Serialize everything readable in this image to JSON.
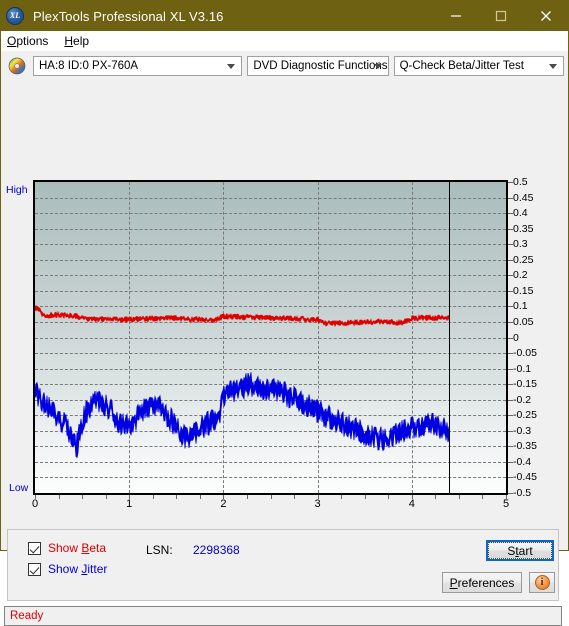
{
  "window": {
    "title": "PlexTools Professional XL V3.16",
    "icon": "app-xl-icon",
    "icon_text": "XL",
    "titlebar_color": "#6e6111",
    "minimize_label": "Minimize",
    "maximize_label": "Maximize",
    "close_label": "Close"
  },
  "menubar": {
    "items": [
      {
        "label": "Options",
        "accel": "O"
      },
      {
        "label": "Help",
        "accel": "H"
      }
    ]
  },
  "toolbar": {
    "drive_icon": "optical-disc-icon",
    "drive_select": {
      "value": "HA:8 ID:0  PX-760A",
      "options": [
        "HA:8 ID:0  PX-760A"
      ]
    },
    "function_select": {
      "value": "DVD Diagnostic Functions",
      "options": [
        "DVD Diagnostic Functions"
      ]
    },
    "test_select": {
      "value": "Q-Check Beta/Jitter Test",
      "options": [
        "Q-Check Beta/Jitter Test"
      ]
    }
  },
  "controls": {
    "show_beta": {
      "label_prefix": "Show ",
      "label_accel": "B",
      "label_suffix": "eta",
      "checked": true,
      "color": "#e00000"
    },
    "show_jitter": {
      "label_prefix": "Show ",
      "label_accel": "J",
      "label_suffix": "itter",
      "checked": true,
      "color": "#0000e0"
    },
    "lsn_label": "LSN:",
    "lsn_value": "2298368",
    "start_button": {
      "prefix": "S",
      "accel": "t",
      "suffix": "art",
      "label": "Start",
      "focused": true
    },
    "preferences_button": {
      "accel": "P",
      "suffix": "references",
      "label": "Preferences"
    },
    "info_button": {
      "icon": "info-icon",
      "glyph": "i"
    }
  },
  "statusbar": {
    "text": "Ready",
    "color": "#e00000"
  },
  "chart_data": {
    "type": "line",
    "title": "Q-Check Beta/Jitter Test",
    "xlabel": "",
    "ylabel": "",
    "y_axis_high_label": "High",
    "y_axis_low_label": "Low",
    "xlim": [
      0,
      5
    ],
    "ylim": [
      -0.5,
      0.5
    ],
    "xticks": [
      0,
      1,
      2,
      3,
      4,
      5
    ],
    "yticks": [
      0.5,
      0.45,
      0.4,
      0.35,
      0.3,
      0.25,
      0.2,
      0.15,
      0.1,
      0.05,
      0,
      -0.05,
      -0.1,
      -0.15,
      -0.2,
      -0.25,
      -0.3,
      -0.35,
      -0.4,
      -0.45,
      -0.5
    ],
    "grid": true,
    "grid_style": "dashed",
    "grid_color": "#7a7a7a",
    "legend_position": "external-checkboxes",
    "data_end_x": 4.4,
    "background_gradient": [
      "#a9bcbc",
      "#fcfdfd"
    ],
    "series": [
      {
        "name": "Beta",
        "color": "#e00000",
        "x": [
          0.0,
          0.04,
          0.08,
          0.12,
          0.18,
          0.24,
          0.3,
          0.36,
          0.42,
          0.5,
          0.6,
          0.7,
          0.8,
          0.9,
          1.0,
          1.1,
          1.2,
          1.3,
          1.4,
          1.5,
          1.6,
          1.7,
          1.8,
          1.85,
          1.9,
          2.0,
          2.1,
          2.2,
          2.3,
          2.4,
          2.5,
          2.6,
          2.7,
          2.8,
          2.9,
          3.0,
          3.05,
          3.1,
          3.2,
          3.3,
          3.4,
          3.5,
          3.6,
          3.7,
          3.8,
          3.85,
          3.9,
          4.0,
          4.1,
          4.2,
          4.3,
          4.4
        ],
        "y": [
          0.095,
          0.093,
          0.072,
          0.07,
          0.072,
          0.073,
          0.072,
          0.071,
          0.07,
          0.062,
          0.06,
          0.06,
          0.059,
          0.058,
          0.058,
          0.059,
          0.06,
          0.062,
          0.063,
          0.062,
          0.06,
          0.058,
          0.057,
          0.056,
          0.055,
          0.068,
          0.067,
          0.066,
          0.065,
          0.064,
          0.063,
          0.062,
          0.061,
          0.06,
          0.059,
          0.058,
          0.046,
          0.045,
          0.046,
          0.047,
          0.048,
          0.049,
          0.05,
          0.051,
          0.05,
          0.048,
          0.047,
          0.062,
          0.063,
          0.064,
          0.063,
          0.062
        ],
        "noise_amplitude": 0.008
      },
      {
        "name": "Jitter",
        "color": "#0000e0",
        "x": [
          0.0,
          0.03,
          0.06,
          0.1,
          0.16,
          0.22,
          0.28,
          0.34,
          0.4,
          0.44,
          0.48,
          0.52,
          0.56,
          0.6,
          0.66,
          0.72,
          0.8,
          0.88,
          0.96,
          1.04,
          1.12,
          1.2,
          1.28,
          1.36,
          1.44,
          1.52,
          1.6,
          1.68,
          1.76,
          1.84,
          1.92,
          1.96,
          2.0,
          2.08,
          2.16,
          2.24,
          2.32,
          2.4,
          2.48,
          2.56,
          2.64,
          2.72,
          2.8,
          2.88,
          2.96,
          3.04,
          3.12,
          3.2,
          3.28,
          3.36,
          3.44,
          3.52,
          3.6,
          3.68,
          3.76,
          3.84,
          3.92,
          4.0,
          4.08,
          4.16,
          4.24,
          4.32,
          4.4
        ],
        "y": [
          -0.155,
          -0.185,
          -0.2,
          -0.215,
          -0.225,
          -0.245,
          -0.265,
          -0.295,
          -0.33,
          -0.355,
          -0.3,
          -0.255,
          -0.23,
          -0.215,
          -0.21,
          -0.215,
          -0.235,
          -0.265,
          -0.29,
          -0.275,
          -0.245,
          -0.225,
          -0.22,
          -0.23,
          -0.265,
          -0.3,
          -0.32,
          -0.31,
          -0.29,
          -0.275,
          -0.265,
          -0.245,
          -0.19,
          -0.175,
          -0.17,
          -0.155,
          -0.15,
          -0.16,
          -0.175,
          -0.17,
          -0.18,
          -0.19,
          -0.2,
          -0.215,
          -0.23,
          -0.245,
          -0.255,
          -0.265,
          -0.28,
          -0.29,
          -0.3,
          -0.31,
          -0.32,
          -0.325,
          -0.32,
          -0.31,
          -0.3,
          -0.295,
          -0.29,
          -0.285,
          -0.28,
          -0.29,
          -0.3
        ],
        "noise_amplitude": 0.035
      }
    ]
  }
}
